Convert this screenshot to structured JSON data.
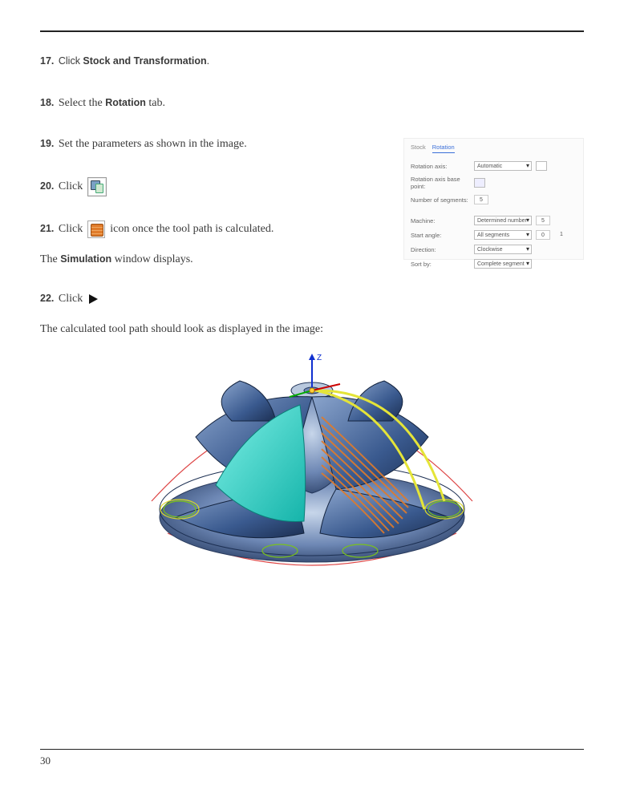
{
  "page_number": "30",
  "steps": {
    "s17": {
      "num": "17.",
      "pre": " Click ",
      "bold": "Stock and Transformation",
      "post": "."
    },
    "s18": {
      "num": "18.",
      "pre": " Select the ",
      "bold": "Rotation",
      "post": " tab."
    },
    "s19": {
      "num": "19.",
      "pre": " Set the parameters as shown in the image."
    },
    "s20": {
      "num": "20.",
      "pre": " Click ",
      "icon": "calculate-icon"
    },
    "s21": {
      "num": "21.",
      "pre": " Click ",
      "icon": "toolpath-icon",
      "post": " icon once the tool path is calculated."
    },
    "s22": {
      "num": "22.",
      "pre": " Click ",
      "icon": "play-icon"
    }
  },
  "body": {
    "sim_line_pre": "The ",
    "sim_line_bold": "Simulation",
    "sim_line_post": " window displays.",
    "calc_line": "The calculated tool path should look as displayed in the image:"
  },
  "panel": {
    "tabs": {
      "stock": "Stock",
      "rotation": "Rotation"
    },
    "rows": {
      "rotation_axis": {
        "label": "Rotation axis:",
        "value": "Automatic"
      },
      "rotation_base": {
        "label": "Rotation axis base point:"
      },
      "num_segments": {
        "label": "Number of segments:",
        "value": "5"
      },
      "machine": {
        "label": "Machine:",
        "value": "Determined number",
        "num": "5"
      },
      "start_angle": {
        "label": "Start angle:",
        "value": "All segments",
        "num": "0",
        "num2": "1"
      },
      "direction": {
        "label": "Direction:",
        "value": "Clockwise"
      },
      "sort_by": {
        "label": "Sort by:",
        "value": "Complete segment"
      }
    }
  },
  "axes": {
    "z": "Z"
  }
}
